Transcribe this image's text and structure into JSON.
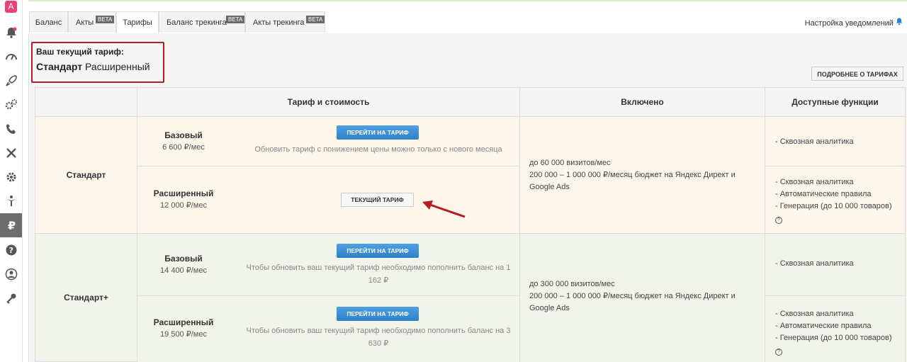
{
  "sidebar": {
    "logo_letter": "A",
    "icons": [
      "bell-icon",
      "speedometer-icon",
      "rocket-icon",
      "gears-icon",
      "phone-icon",
      "tools-icon",
      "gear-icon",
      "person-icon",
      "ruble-icon",
      "question-icon",
      "user-icon",
      "key-icon"
    ]
  },
  "tabs": [
    {
      "label": "Баланс"
    },
    {
      "label": "Акты",
      "badge": "BETA"
    },
    {
      "label": "Тарифы"
    },
    {
      "label": "Баланс трекинга",
      "badge": "BETA"
    },
    {
      "label": "Акты трекинга",
      "badge": "BETA"
    }
  ],
  "notifications_label": "Настройка уведомлений",
  "current_tariff": {
    "label": "Ваш текущий тариф:",
    "plan": "Стандарт",
    "level": "Расширенный"
  },
  "more_button": "ПОДРОБНЕЕ О ТАРИФАХ",
  "table": {
    "headers": [
      "Тариф и стоимость",
      "Включено",
      "Доступные функции"
    ],
    "groups": [
      {
        "name": "Стандарт",
        "included": [
          "до 60 000 визитов/мес",
          "200 000 – 1 000 000 ₽/месяц бюджет на Яндекс Директ и Google Ads"
        ],
        "rows": [
          {
            "name": "Базовый",
            "price": "6 600 ₽/мес",
            "button": "ПЕРЕЙТИ НА ТАРИФ",
            "note": "Обновить тариф с понижением цены можно только с нового месяца",
            "features": [
              "- Сквозная аналитика"
            ]
          },
          {
            "name": "Расширенный",
            "price": "12 000 ₽/мес",
            "button": "ТЕКУЩИЙ ТАРИФ",
            "note": "",
            "features": [
              "- Сквозная аналитика",
              "- Автоматические правила",
              "- Генерация (до 10 000 товаров)"
            ],
            "help": "?"
          }
        ]
      },
      {
        "name": "Стандарт+",
        "included": [
          "до 300 000 визитов/мес",
          "200 000 – 1 000 000 ₽/месяц бюджет на Яндекс Директ и Google Ads"
        ],
        "rows": [
          {
            "name": "Базовый",
            "price": "14 400 ₽/мес",
            "button": "ПЕРЕЙТИ НА ТАРИФ",
            "note": "Чтобы обновить ваш текущий тариф необходимо пополнить баланс на 1 162 ₽",
            "features": [
              "- Сквозная аналитика"
            ]
          },
          {
            "name": "Расширенный",
            "price": "19 500 ₽/мес",
            "button": "ПЕРЕЙТИ НА ТАРИФ",
            "note": "Чтобы обновить ваш текущий тариф необходимо пополнить баланс на 3 630 ₽",
            "features": [
              "- Сквозная аналитика",
              "- Автоматические правила",
              "- Генерация (до 10 000 товаров)"
            ],
            "help": "?"
          }
        ]
      }
    ]
  },
  "colors": {
    "brand": "#e8407a",
    "highlight_border": "#b51d24",
    "primary_button": "#2f80c8",
    "standard_row": "#fdf6ea",
    "standard_plus_row": "#f0f4ea"
  }
}
